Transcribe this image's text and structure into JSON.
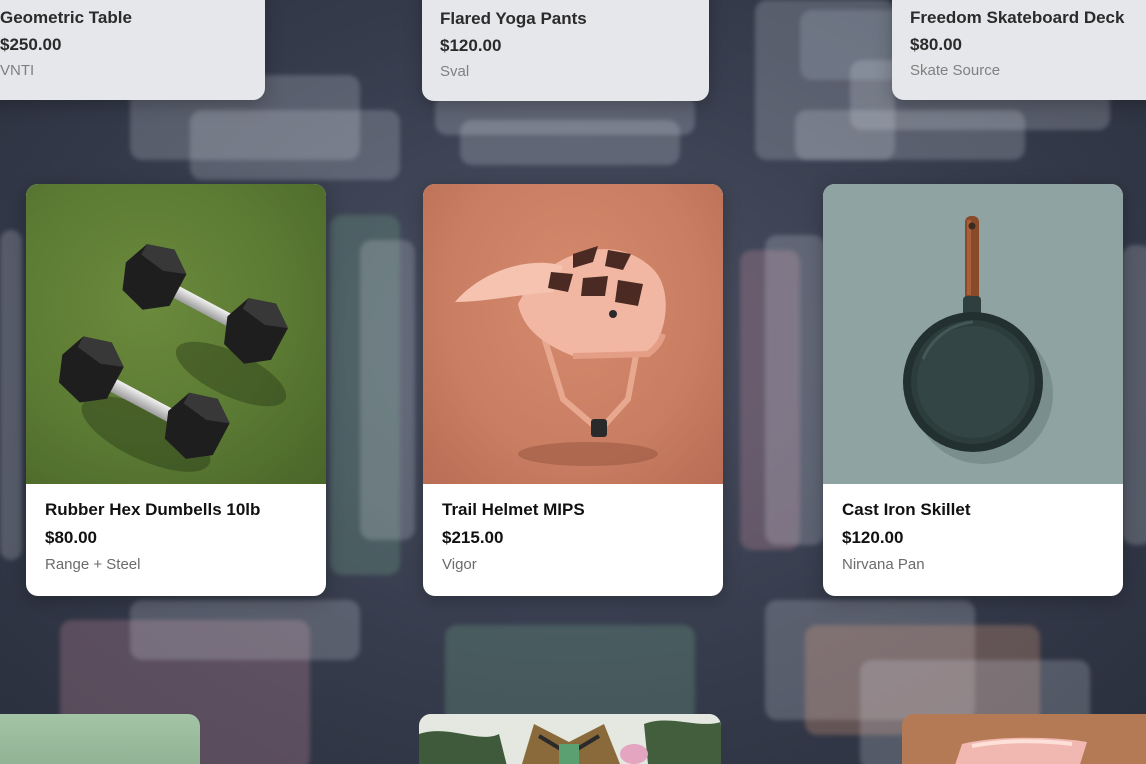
{
  "top_row": [
    {
      "title": "Geometric Table",
      "price": "$250.00",
      "brand": "VNTI"
    },
    {
      "title": "Flared Yoga Pants",
      "price": "$120.00",
      "brand": "Sval"
    },
    {
      "title": "Freedom Skateboard Deck",
      "price": "$80.00",
      "brand": "Skate Source"
    }
  ],
  "main_row": [
    {
      "title": "Rubber Hex Dumbells 10lb",
      "price": "$80.00",
      "brand": "Range + Steel",
      "image": "dumbbells-on-turf"
    },
    {
      "title": "Trail Helmet MIPS",
      "price": "$215.00",
      "brand": "Vigor",
      "image": "pink-bike-helmet"
    },
    {
      "title": "Cast Iron Skillet",
      "price": "$120.00",
      "brand": "Nirvana Pan",
      "image": "skillet-on-teal"
    }
  ],
  "bottom_row": [
    {
      "image": "green-product"
    },
    {
      "image": "person-in-jacket"
    },
    {
      "image": "pink-product-on-tan"
    }
  ],
  "colors": {
    "background": "#363c4c",
    "card": "#ffffff",
    "text_primary": "#111111",
    "text_secondary": "#6b6b6b",
    "dumbbell_turf": "#5b7a33",
    "helmet_bg": "#c97d62",
    "skillet_bg": "#8ea3a2"
  }
}
